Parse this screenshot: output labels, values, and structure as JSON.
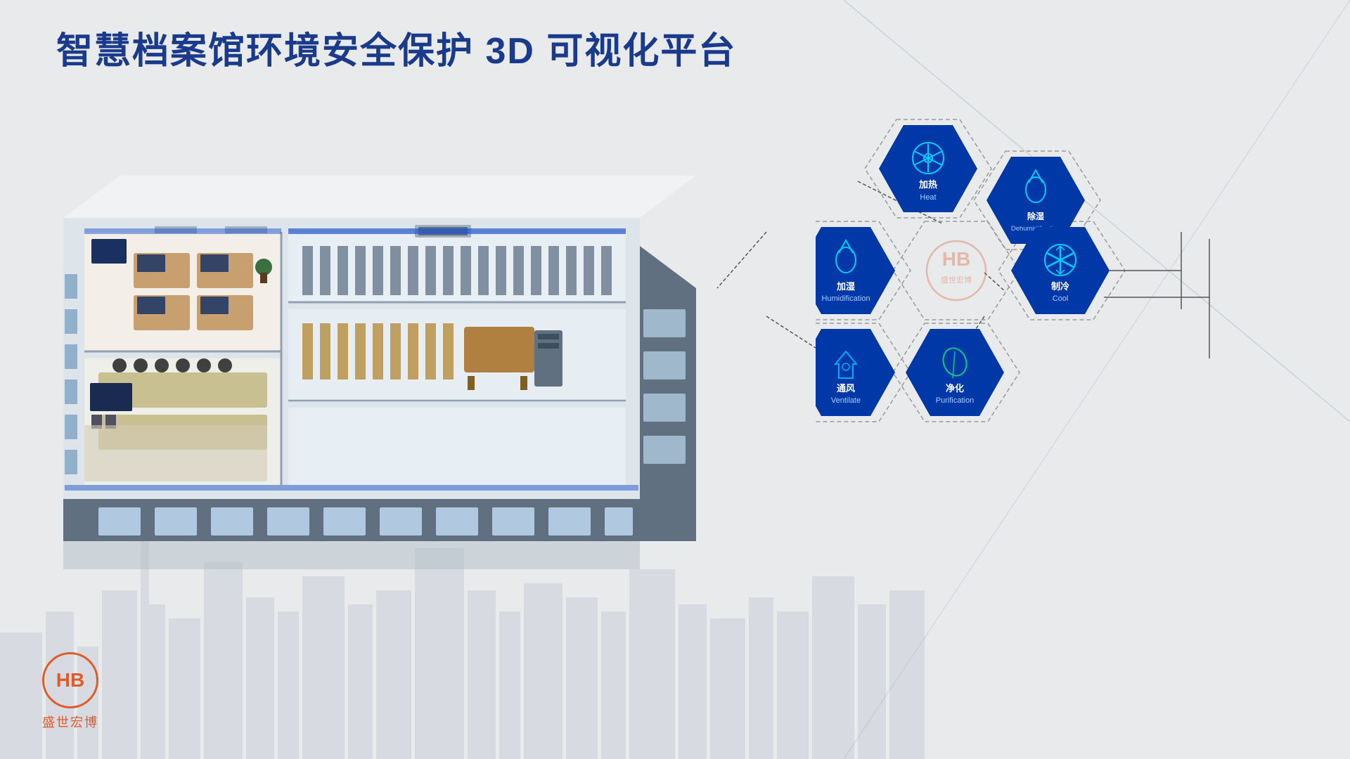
{
  "title": "智慧档案馆环境安全保护 3D 可视化平台",
  "logo": {
    "symbol": "HB",
    "name": "盛世宏博"
  },
  "hexagons": [
    {
      "id": "heat",
      "label_cn": "加热",
      "label_en": "Heat",
      "icon": "❄",
      "icon_type": "snowflake-alt",
      "col": 1,
      "row": 0,
      "filled": true
    },
    {
      "id": "dehumidification",
      "label_cn": "除湿",
      "label_en": "Dehumidification",
      "icon": "💧",
      "icon_type": "droplet",
      "col": 2,
      "row": 0,
      "filled": true
    },
    {
      "id": "humidification",
      "label_cn": "加湿",
      "label_en": "Humidification",
      "icon": "💧",
      "icon_type": "water-drop",
      "col": 0,
      "row": 1,
      "filled": true
    },
    {
      "id": "cool",
      "label_cn": "制冷",
      "label_en": "Cool",
      "icon": "❄",
      "icon_type": "snowflake",
      "col": 2,
      "row": 1,
      "filled": true
    },
    {
      "id": "purification",
      "label_cn": "净化",
      "label_en": "Purification",
      "icon": "🌿",
      "icon_type": "leaf",
      "col": 2,
      "row": 2,
      "filled": true
    },
    {
      "id": "ventilate",
      "label_cn": "通风",
      "label_en": "Ventilate",
      "icon": "🏠",
      "icon_type": "house-wind",
      "col": 0,
      "row": 2,
      "filled": true
    }
  ],
  "colors": {
    "title": "#1a3a8c",
    "hex_filled_bg": "#0038a8",
    "hex_outline_stroke": "#999",
    "logo_color": "#e05a2a",
    "line_color": "#2255cc"
  }
}
